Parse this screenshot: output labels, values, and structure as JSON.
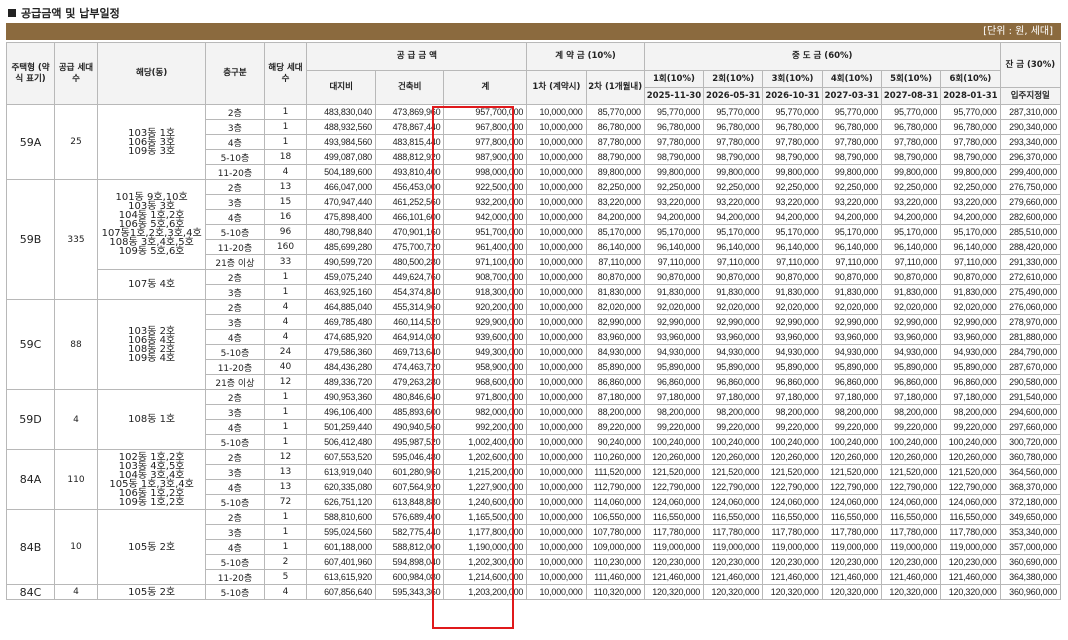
{
  "title": "공급금액 및 납부일정",
  "unit": "[단위 : 원, 세대]",
  "headers": {
    "type": "주택형 (약식 표기)",
    "households": "공급 세대수",
    "dong": "해당(동)",
    "floor": "층구분",
    "units": "해당 세대수",
    "supply": "공 급 금 액",
    "land": "대지비",
    "building": "건축비",
    "total": "계",
    "deposit": "계 약 금 (10%)",
    "dep1": "1차 (계약시)",
    "dep2": "2차 (1개월내)",
    "middle": "중 도 금 (60%)",
    "mid_labels": [
      "1회(10%)",
      "2회(10%)",
      "3회(10%)",
      "4회(10%)",
      "5회(10%)",
      "6회(10%)"
    ],
    "mid_dates": [
      "2025-11-30",
      "2026-05-31",
      "2026-10-31",
      "2027-03-31",
      "2027-08-31",
      "2028-01-31"
    ],
    "balance": "잔 금 (30%)",
    "balance_sub": "입주지정일"
  },
  "groups": [
    {
      "type": "59A",
      "households": "25",
      "subgroups": [
        {
          "dong": "103동 1호\n106동 3호\n109동 3호",
          "rows": [
            [
              "2층",
              "1",
              "483,830,040",
              "473,869,960",
              "957,700,000",
              "10,000,000",
              "85,770,000",
              "95,770,000",
              "287,310,000"
            ],
            [
              "3층",
              "1",
              "488,932,560",
              "478,867,440",
              "967,800,000",
              "10,000,000",
              "86,780,000",
              "96,780,000",
              "290,340,000"
            ],
            [
              "4층",
              "1",
              "493,984,560",
              "483,815,440",
              "977,800,000",
              "10,000,000",
              "87,780,000",
              "97,780,000",
              "293,340,000"
            ],
            [
              "5-10층",
              "18",
              "499,087,080",
              "488,812,920",
              "987,900,000",
              "10,000,000",
              "88,790,000",
              "98,790,000",
              "296,370,000"
            ],
            [
              "11-20층",
              "4",
              "504,189,600",
              "493,810,400",
              "998,000,000",
              "10,000,000",
              "89,800,000",
              "99,800,000",
              "299,400,000"
            ]
          ]
        }
      ]
    },
    {
      "type": "59B",
      "households": "335",
      "subgroups": [
        {
          "dong": "101동 9호,10호\n103동 3호\n104동 1호,2호\n106동 5호,6호\n107동1호,2호,3호,4호\n108동 3호,4호,5호\n109동 5호,6호",
          "rows": [
            [
              "2층",
              "13",
              "466,047,000",
              "456,453,000",
              "922,500,000",
              "10,000,000",
              "82,250,000",
              "92,250,000",
              "276,750,000"
            ],
            [
              "3층",
              "15",
              "470,947,440",
              "461,252,560",
              "932,200,000",
              "10,000,000",
              "83,220,000",
              "93,220,000",
              "279,660,000"
            ],
            [
              "4층",
              "16",
              "475,898,400",
              "466,101,600",
              "942,000,000",
              "10,000,000",
              "84,200,000",
              "94,200,000",
              "282,600,000"
            ],
            [
              "5-10층",
              "96",
              "480,798,840",
              "470,901,160",
              "951,700,000",
              "10,000,000",
              "85,170,000",
              "95,170,000",
              "285,510,000"
            ],
            [
              "11-20층",
              "160",
              "485,699,280",
              "475,700,720",
              "961,400,000",
              "10,000,000",
              "86,140,000",
              "96,140,000",
              "288,420,000"
            ],
            [
              "21층 이상",
              "33",
              "490,599,720",
              "480,500,280",
              "971,100,000",
              "10,000,000",
              "87,110,000",
              "97,110,000",
              "291,330,000"
            ]
          ]
        },
        {
          "dong": "107동 4호",
          "rows": [
            [
              "2층",
              "1",
              "459,075,240",
              "449,624,760",
              "908,700,000",
              "10,000,000",
              "80,870,000",
              "90,870,000",
              "272,610,000"
            ],
            [
              "3층",
              "1",
              "463,925,160",
              "454,374,840",
              "918,300,000",
              "10,000,000",
              "81,830,000",
              "91,830,000",
              "275,490,000"
            ]
          ]
        }
      ]
    },
    {
      "type": "59C",
      "households": "88",
      "subgroups": [
        {
          "dong": "103동 2호\n106동 4호\n108동 2호\n109동 4호",
          "rows": [
            [
              "2층",
              "4",
              "464,885,040",
              "455,314,960",
              "920,200,000",
              "10,000,000",
              "82,020,000",
              "92,020,000",
              "276,060,000"
            ],
            [
              "3층",
              "4",
              "469,785,480",
              "460,114,520",
              "929,900,000",
              "10,000,000",
              "82,990,000",
              "92,990,000",
              "278,970,000"
            ],
            [
              "4층",
              "4",
              "474,685,920",
              "464,914,080",
              "939,600,000",
              "10,000,000",
              "83,960,000",
              "93,960,000",
              "281,880,000"
            ],
            [
              "5-10층",
              "24",
              "479,586,360",
              "469,713,640",
              "949,300,000",
              "10,000,000",
              "84,930,000",
              "94,930,000",
              "284,790,000"
            ],
            [
              "11-20층",
              "40",
              "484,436,280",
              "474,463,720",
              "958,900,000",
              "10,000,000",
              "85,890,000",
              "95,890,000",
              "287,670,000"
            ],
            [
              "21층 이상",
              "12",
              "489,336,720",
              "479,263,280",
              "968,600,000",
              "10,000,000",
              "86,860,000",
              "96,860,000",
              "290,580,000"
            ]
          ]
        }
      ]
    },
    {
      "type": "59D",
      "households": "4",
      "subgroups": [
        {
          "dong": "108동 1호",
          "rows": [
            [
              "2층",
              "1",
              "490,953,360",
              "480,846,640",
              "971,800,000",
              "10,000,000",
              "87,180,000",
              "97,180,000",
              "291,540,000"
            ],
            [
              "3층",
              "1",
              "496,106,400",
              "485,893,600",
              "982,000,000",
              "10,000,000",
              "88,200,000",
              "98,200,000",
              "294,600,000"
            ],
            [
              "4층",
              "1",
              "501,259,440",
              "490,940,560",
              "992,200,000",
              "10,000,000",
              "89,220,000",
              "99,220,000",
              "297,660,000"
            ],
            [
              "5-10층",
              "1",
              "506,412,480",
              "495,987,520",
              "1,002,400,000",
              "10,000,000",
              "90,240,000",
              "100,240,000",
              "300,720,000"
            ]
          ]
        }
      ]
    },
    {
      "type": "84A",
      "households": "110",
      "subgroups": [
        {
          "dong": "102동 1호,2호\n103동 4호,5호\n104동 3호,4호\n105동 1호,3호,4호\n106동 1호,2호\n109동 1호,2호",
          "rows": [
            [
              "2층",
              "12",
              "607,553,520",
              "595,046,480",
              "1,202,600,000",
              "10,000,000",
              "110,260,000",
              "120,260,000",
              "360,780,000"
            ],
            [
              "3층",
              "13",
              "613,919,040",
              "601,280,960",
              "1,215,200,000",
              "10,000,000",
              "111,520,000",
              "121,520,000",
              "364,560,000"
            ],
            [
              "4층",
              "13",
              "620,335,080",
              "607,564,920",
              "1,227,900,000",
              "10,000,000",
              "112,790,000",
              "122,790,000",
              "368,370,000"
            ],
            [
              "5-10층",
              "72",
              "626,751,120",
              "613,848,880",
              "1,240,600,000",
              "10,000,000",
              "114,060,000",
              "124,060,000",
              "372,180,000"
            ]
          ]
        }
      ]
    },
    {
      "type": "84B",
      "households": "10",
      "subgroups": [
        {
          "dong": "105동 2호",
          "rows": [
            [
              "2층",
              "1",
              "588,810,600",
              "576,689,400",
              "1,165,500,000",
              "10,000,000",
              "106,550,000",
              "116,550,000",
              "349,650,000"
            ],
            [
              "3층",
              "1",
              "595,024,560",
              "582,775,440",
              "1,177,800,000",
              "10,000,000",
              "107,780,000",
              "117,780,000",
              "353,340,000"
            ],
            [
              "4층",
              "1",
              "601,188,000",
              "588,812,000",
              "1,190,000,000",
              "10,000,000",
              "109,000,000",
              "119,000,000",
              "357,000,000"
            ],
            [
              "5-10층",
              "2",
              "607,401,960",
              "594,898,040",
              "1,202,300,000",
              "10,000,000",
              "110,230,000",
              "120,230,000",
              "360,690,000"
            ],
            [
              "11-20층",
              "5",
              "613,615,920",
              "600,984,080",
              "1,214,600,000",
              "10,000,000",
              "111,460,000",
              "121,460,000",
              "364,380,000"
            ]
          ]
        }
      ]
    },
    {
      "type": "84C",
      "households": "4",
      "subgroups": [
        {
          "dong": "105동 2호",
          "rows": [
            [
              "5-10층",
              "4",
              "607,856,640",
              "595,343,360",
              "1,203,200,000",
              "10,000,000",
              "110,320,000",
              "120,320,000",
              "360,960,000"
            ]
          ]
        }
      ]
    }
  ]
}
